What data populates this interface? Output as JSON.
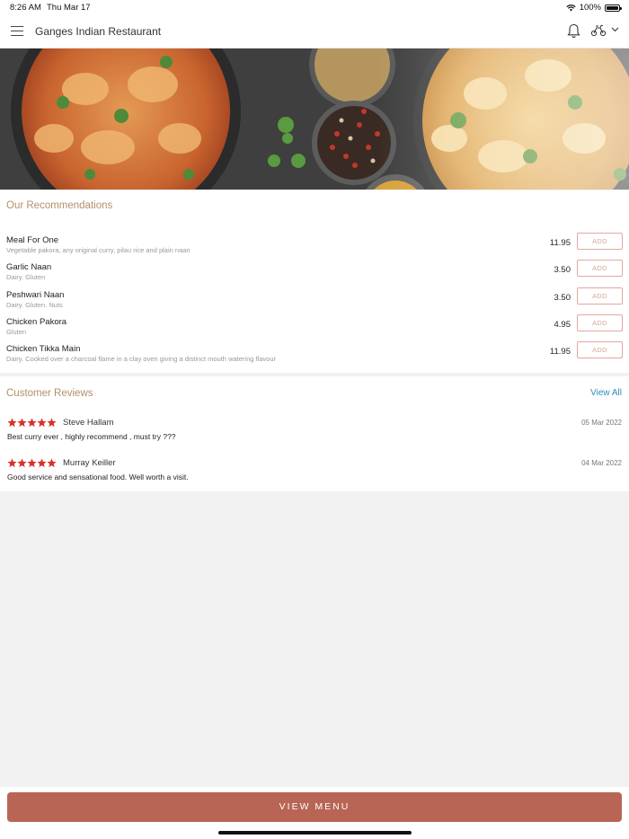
{
  "status_bar": {
    "time": "8:26 AM",
    "date": "Thu Mar 17",
    "battery": "100%"
  },
  "header": {
    "title": "Ganges Indian Restaurant"
  },
  "recommendations": {
    "title": "Our Recommendations",
    "add_label": "ADD",
    "items": [
      {
        "name": "Meal For One",
        "desc": "Vegetable pakora, any original curry, pilau rice and plain naan",
        "price": "11.95"
      },
      {
        "name": "Garlic Naan",
        "desc": "Dairy. Gluten",
        "price": "3.50"
      },
      {
        "name": "Peshwari Naan",
        "desc": "Dairy. Gluten. Nuts",
        "price": "3.50"
      },
      {
        "name": "Chicken Pakora",
        "desc": "Gluten",
        "price": "4.95"
      },
      {
        "name": "Chicken Tikka Main",
        "desc": "Dairy. Cooked over a charcoal flame in a clay oven giving a distinct mouth watering flavour",
        "price": "11.95"
      }
    ]
  },
  "reviews": {
    "title": "Customer Reviews",
    "view_all": "View All",
    "items": [
      {
        "name": "Steve Hallam",
        "date": "05 Mar 2022",
        "text": "Best curry ever , highly recommend , must try ???",
        "rating": 5
      },
      {
        "name": "Murray Keiller",
        "date": "04 Mar 2022",
        "text": "Good service and sensational food. Well worth a visit.",
        "rating": 5
      }
    ]
  },
  "footer": {
    "button": "VIEW MENU"
  },
  "colors": {
    "accent": "#b86555",
    "section_title": "#b2906b",
    "link": "#2f8bbd",
    "star": "#d8312c"
  }
}
